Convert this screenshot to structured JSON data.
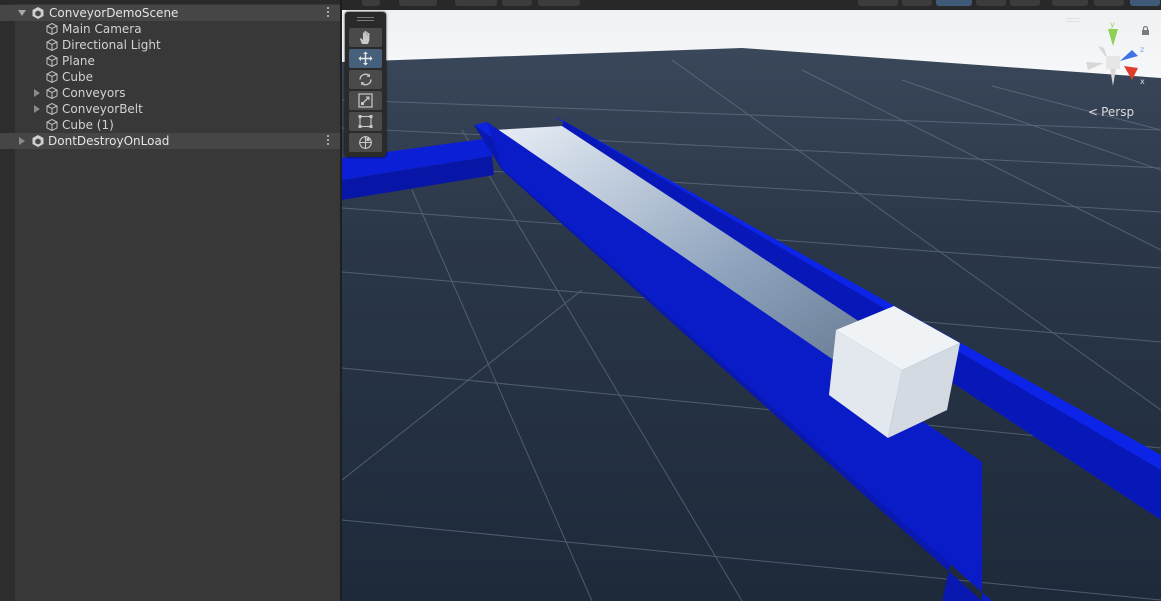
{
  "hierarchy": {
    "scene_name": "ConveyorDemoScene",
    "items": [
      {
        "label": "Main Camera",
        "expandable": false
      },
      {
        "label": "Directional Light",
        "expandable": false
      },
      {
        "label": "Plane",
        "expandable": false
      },
      {
        "label": "Cube",
        "expandable": false
      },
      {
        "label": "Conveyors",
        "expandable": true
      },
      {
        "label": "ConveyorBelt",
        "expandable": true
      },
      {
        "label": "Cube (1)",
        "expandable": false
      }
    ],
    "second_scene_name": "DontDestroyOnLoad"
  },
  "scene_view": {
    "projection_label": "Persp",
    "gizmo_axes": {
      "x": "x",
      "y": "y",
      "z": "z"
    },
    "colors": {
      "sky": "#f2f3f4",
      "ground": "#263345",
      "conveyor_rail": "#0a1fd0",
      "belt": "#c9d3e0",
      "cube": "#e6ebf1",
      "grid_line": "#6f7c8f"
    }
  },
  "tools": [
    {
      "name": "hand-tool",
      "icon": "hand-icon",
      "active": false
    },
    {
      "name": "move-tool",
      "icon": "move-icon",
      "active": true
    },
    {
      "name": "rotate-tool",
      "icon": "rotate-icon",
      "active": false
    },
    {
      "name": "scale-tool",
      "icon": "scale-icon",
      "active": false
    },
    {
      "name": "rect-tool",
      "icon": "rect-transform-icon",
      "active": false
    },
    {
      "name": "transform-tool",
      "icon": "transform-icon",
      "active": false
    }
  ]
}
